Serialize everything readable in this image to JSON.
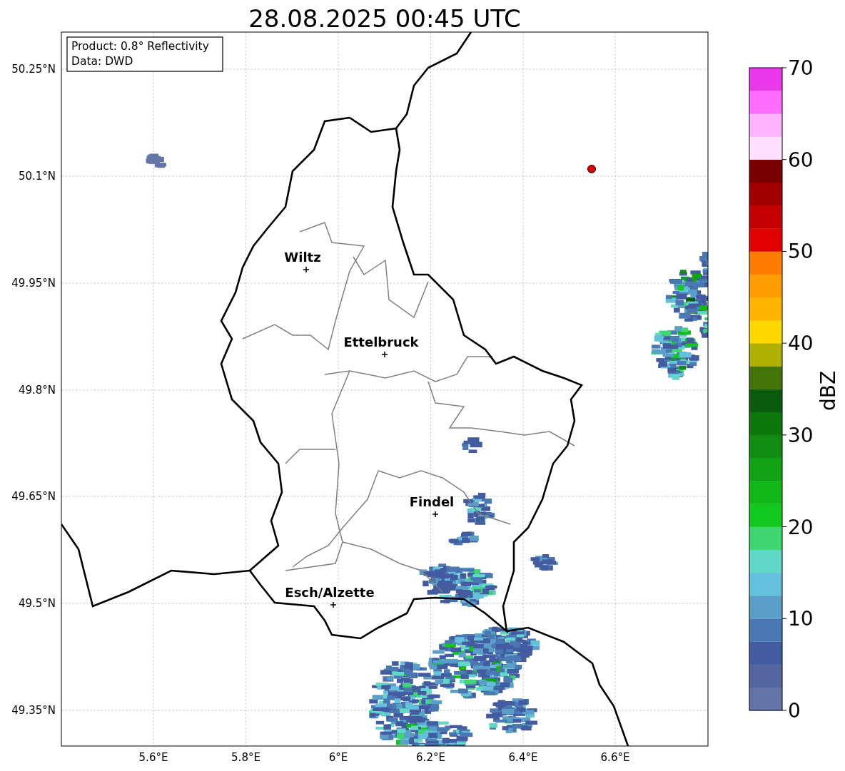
{
  "title": "28.08.2025 00:45 UTC",
  "info_box": [
    "Product: 0.8° Reflectivity",
    "Data: DWD"
  ],
  "map": {
    "x_tick_labels": [
      "5.6°E",
      "5.8°E",
      "6°E",
      "6.2°E",
      "6.4°E",
      "6.6°E"
    ],
    "y_tick_labels": [
      "50.25°N",
      "50.1°N",
      "49.95°N",
      "49.8°N",
      "49.65°N",
      "49.5°N",
      "49.35°N"
    ],
    "cities": [
      {
        "name": "Wiltz"
      },
      {
        "name": "Ettelbruck"
      },
      {
        "name": "Findel"
      },
      {
        "name": "Esch/Alzette"
      }
    ]
  },
  "colorbar": {
    "label": "dBZ",
    "tick_labels": [
      "70",
      "60",
      "50",
      "40",
      "30",
      "20",
      "10",
      "0"
    ],
    "segments": [
      {
        "color": "#6474a8"
      },
      {
        "color": "#53669f"
      },
      {
        "color": "#435ba0"
      },
      {
        "color": "#4a78b2"
      },
      {
        "color": "#5a9fc8"
      },
      {
        "color": "#64c0dc"
      },
      {
        "color": "#60d8c8"
      },
      {
        "color": "#3dd670"
      },
      {
        "color": "#10c81e"
      },
      {
        "color": "#10b818"
      },
      {
        "color": "#10a414"
      },
      {
        "color": "#108c10"
      },
      {
        "color": "#0c780c"
      },
      {
        "color": "#085c0c"
      },
      {
        "color": "#447408"
      },
      {
        "color": "#b0b000"
      },
      {
        "color": "#ffd800"
      },
      {
        "color": "#ffb400"
      },
      {
        "color": "#ff9c00"
      },
      {
        "color": "#ff7c00"
      },
      {
        "color": "#e00000"
      },
      {
        "color": "#c40000"
      },
      {
        "color": "#a00000"
      },
      {
        "color": "#780000"
      },
      {
        "color": "#ffe0ff"
      },
      {
        "color": "#ffb4ff"
      },
      {
        "color": "#ff6cff"
      },
      {
        "color": "#ec38ec"
      }
    ]
  }
}
